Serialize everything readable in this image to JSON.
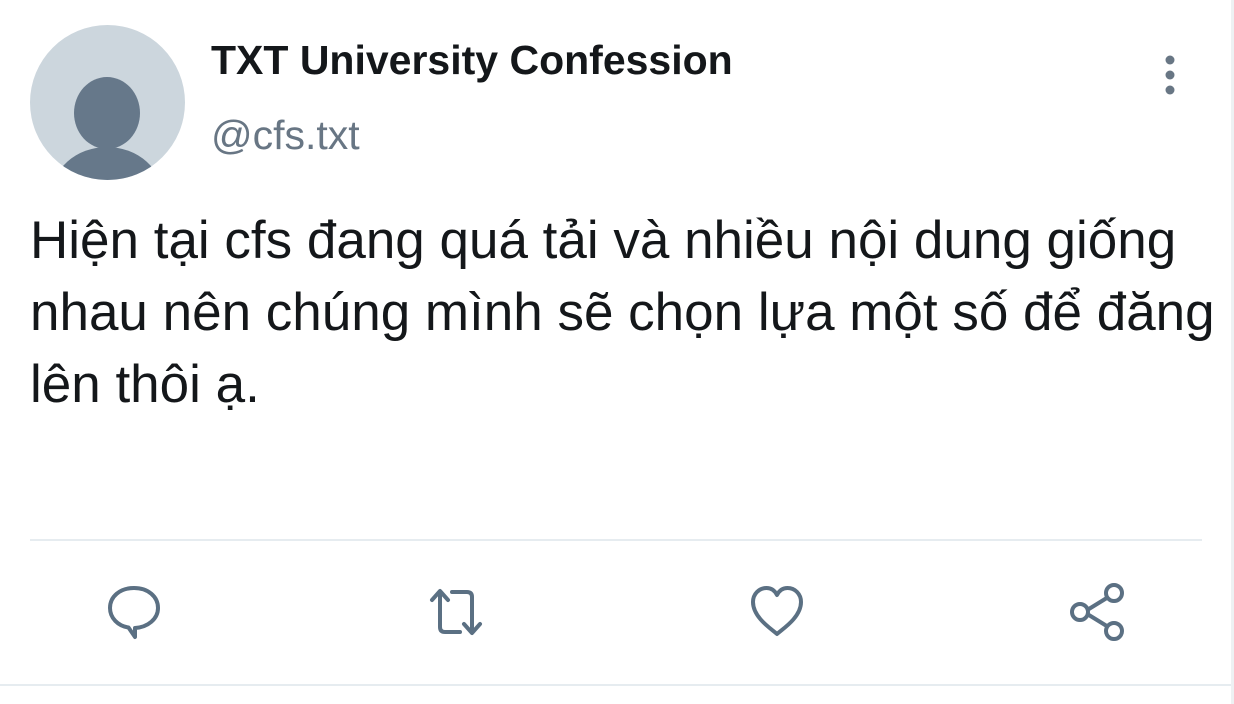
{
  "tweet": {
    "display_name": "TXT University Confession",
    "handle": "@cfs.txt",
    "text": "Hiện tại cfs đang quá tải và nhiều nội dung giống nhau nên chúng mình sẽ chọn lựa một số để đăng lên thôi ạ."
  },
  "icons": {
    "avatar": "default-avatar-silhouette",
    "more": "vertical-ellipsis-icon",
    "reply": "speech-bubble-icon",
    "retweet": "retweet-arrows-icon",
    "like": "heart-icon",
    "share": "share-nodes-icon"
  },
  "colors": {
    "text": "#14171a",
    "secondary": "#687684",
    "icon": "#5b7083",
    "avatar_bg": "#ccd6dd",
    "avatar_fg": "#66788a",
    "divider": "#e6ecf0"
  }
}
